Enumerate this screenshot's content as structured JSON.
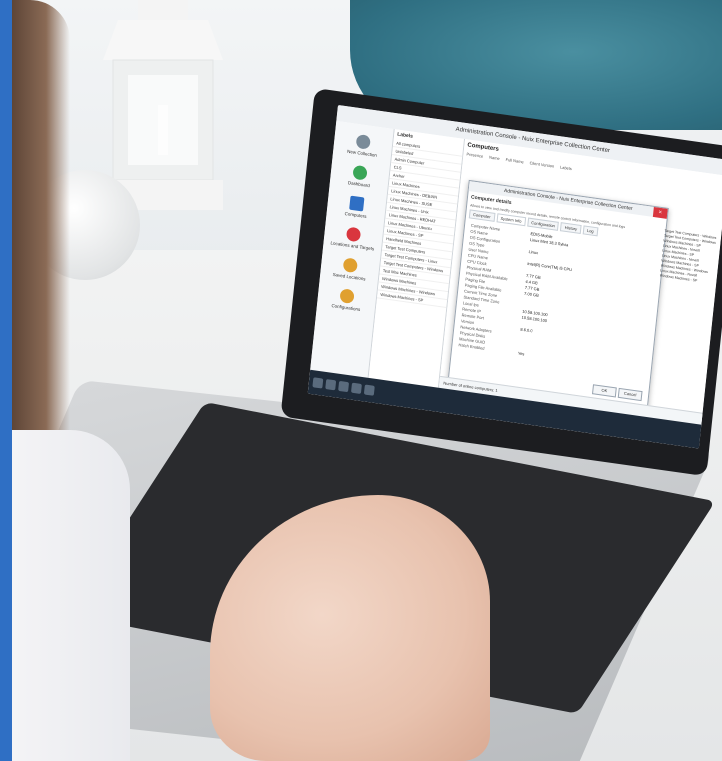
{
  "app": {
    "window_title": "Administration Console - Nuix Enterprise Collection Center"
  },
  "nav": {
    "items": [
      {
        "label": "New Collection",
        "color": "#7a8b99"
      },
      {
        "label": "Dashboard",
        "color": "#3aa657"
      },
      {
        "label": "Computers",
        "color": "#2f6fc4"
      },
      {
        "label": "Locations and Targets",
        "color": "#d9363e"
      },
      {
        "label": "Saved Locations",
        "color": "#e0a030"
      },
      {
        "label": "Configurations",
        "color": "#e0a030"
      }
    ]
  },
  "labels_pane": {
    "header": "Labels",
    "rows": [
      "All computers",
      "Unlabeled",
      "Admin Computer",
      "CLS",
      "Archer",
      "Linux Machines",
      "Linux Machines - DEBIAN",
      "Linux Machines - SUSE",
      "Linux Machines - Unix",
      "Linux Machines - REDHAT",
      "Linux Machines - Ubuntu",
      "Linux Machines - SP",
      "Handheld Machines",
      "Target Test Computers",
      "Target Test Computers - Linux",
      "Target Test Computers - Windows",
      "Test Mac Machines",
      "Windows Machines",
      "Windows Machines - Windows",
      "Windows Machines - SP"
    ]
  },
  "main": {
    "header": "Computers",
    "columns": [
      "Presence",
      "Name",
      "Full Name",
      "Client Version",
      "Labels"
    ]
  },
  "dialog": {
    "title": "Administration Console - Nuix Enterprise Collection Center",
    "heading": "Computer details",
    "subheading": "Allows to view and modify computer record details, remote control information, configuration and logs",
    "tabs": [
      "Computer",
      "System Info",
      "Configuration",
      "History",
      "Log"
    ],
    "active_tab": "System Info",
    "properties": [
      {
        "k": "Computer Name",
        "v": "EDIS-Mobile"
      },
      {
        "k": "OS Name",
        "v": "Linux Mint 18.3 Sylvia"
      },
      {
        "k": "OS Configuration",
        "v": ""
      },
      {
        "k": "OS Type",
        "v": "Linux"
      },
      {
        "k": "User Name",
        "v": ""
      },
      {
        "k": "CPU Name",
        "v": "Intel(R) Core(TM) i5 CPU"
      },
      {
        "k": "CPU Clock",
        "v": ""
      },
      {
        "k": "Physical RAM",
        "v": "7.77 GB"
      },
      {
        "k": "Physical RAM Available",
        "v": "4.4 GB"
      },
      {
        "k": "Paging File",
        "v": "7.77 GB"
      },
      {
        "k": "Paging File Available",
        "v": "7.00 GB"
      },
      {
        "k": "Current Time Zone",
        "v": ""
      },
      {
        "k": "Standard Time Zone",
        "v": ""
      },
      {
        "k": "Local Ips",
        "v": "10.58.100.100"
      },
      {
        "k": "Remote IP",
        "v": "10.58.100.100"
      },
      {
        "k": "Remote Port",
        "v": ""
      },
      {
        "k": "Version",
        "v": "8.6.0.0"
      },
      {
        "k": "Network Adapters",
        "v": ""
      },
      {
        "k": "Physical Disks",
        "v": ""
      },
      {
        "k": "Machine GUID",
        "v": ""
      },
      {
        "k": "Hatch Enabled",
        "v": "Yes"
      }
    ],
    "ok_label": "OK",
    "cancel_label": "Cancel"
  },
  "right_list": [
    "Target Test Computers - Windows",
    "Target Test Computers - Windows",
    "Windows Machines - SP",
    "Linux Machines - Novell",
    "Linux Machines - SP",
    "Linux Machines - Novell",
    "Windows Machines - SP",
    "Windows Machines - Windows",
    "Linux Machines - Novell",
    "Windows Machines - SP"
  ],
  "status_bar": {
    "text": "Number of online computers: 1"
  }
}
